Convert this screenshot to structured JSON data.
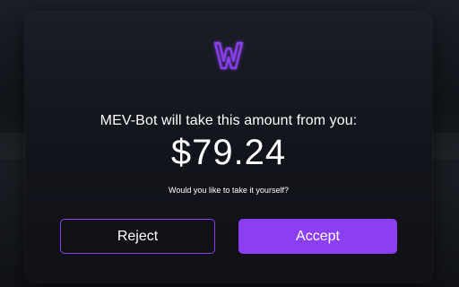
{
  "dialog": {
    "logo_icon": "w-logo-icon",
    "accent_color": "#8b3ff0",
    "headline": "MEV-Bot will take this amount from you:",
    "amount": "$79.24",
    "question": "Would you like to take it yourself?",
    "reject_label": "Reject",
    "accept_label": "Accept"
  }
}
